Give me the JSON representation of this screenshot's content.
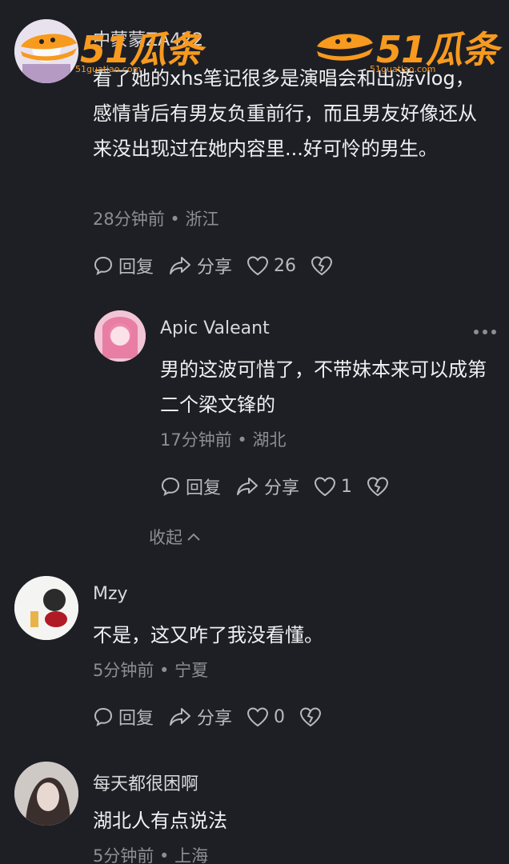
{
  "comments": [
    {
      "username": "中蒙蒙ZA422",
      "text": "看了她的xhs笔记很多是演唱会和出游vlog，感情背后有男友负重前行，而且男友好像还从来没出现过在她内容里...好可怜的男生。",
      "meta": "28分钟前 • 浙江",
      "reply_label": "回复",
      "share_label": "分享",
      "like_count": "26"
    },
    {
      "username": "Apic Valeant",
      "text": "男的这波可惜了，不带妹本来可以成第二个梁文锋的",
      "meta": "17分钟前 • 湖北",
      "reply_label": "回复",
      "share_label": "分享",
      "like_count": "1",
      "collapse_label": "收起"
    },
    {
      "username": "Mzy",
      "text": "不是，这又咋了我没看懂。",
      "meta": "5分钟前 • 宁夏",
      "reply_label": "回复",
      "share_label": "分享",
      "like_count": "0"
    },
    {
      "username": "每天都很困啊",
      "text": "湖北人有点说法",
      "meta": "5分钟前 • 上海"
    }
  ],
  "watermark": {
    "brand": "51瓜条",
    "url": "51guatiao.com"
  },
  "colors": {
    "background": "#1e1f25",
    "text": "#f0f0f2",
    "muted": "#8d8e94",
    "watermark": "#f79a1e"
  }
}
